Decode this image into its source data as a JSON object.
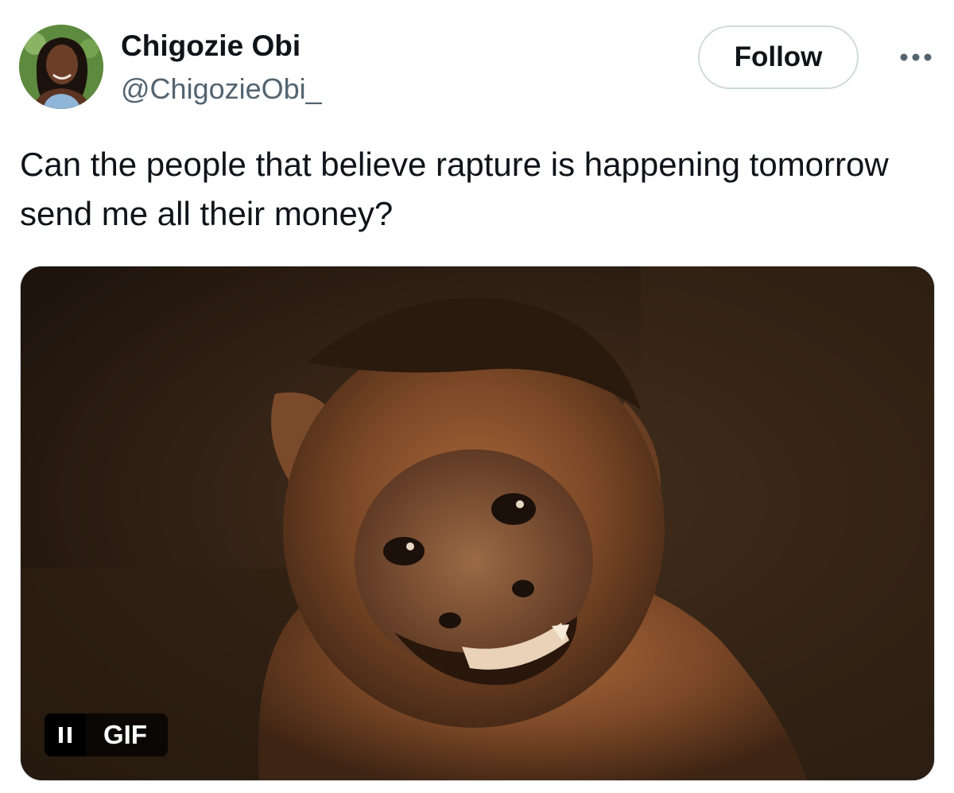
{
  "author": {
    "name": "Chigozie Obi",
    "handle": "@ChigozieObi_"
  },
  "actions": {
    "follow_label": "Follow",
    "more_icon": "more-horizontal-icon"
  },
  "tweet": {
    "text": "Can the people that believe rapture is happening tomorrow send me all their money?"
  },
  "media": {
    "type": "gif",
    "badge_label": "GIF",
    "pause_icon": "pause-icon"
  },
  "colors": {
    "text_primary": "#0f1419",
    "text_secondary": "#536471",
    "border": "#cfd9de"
  }
}
